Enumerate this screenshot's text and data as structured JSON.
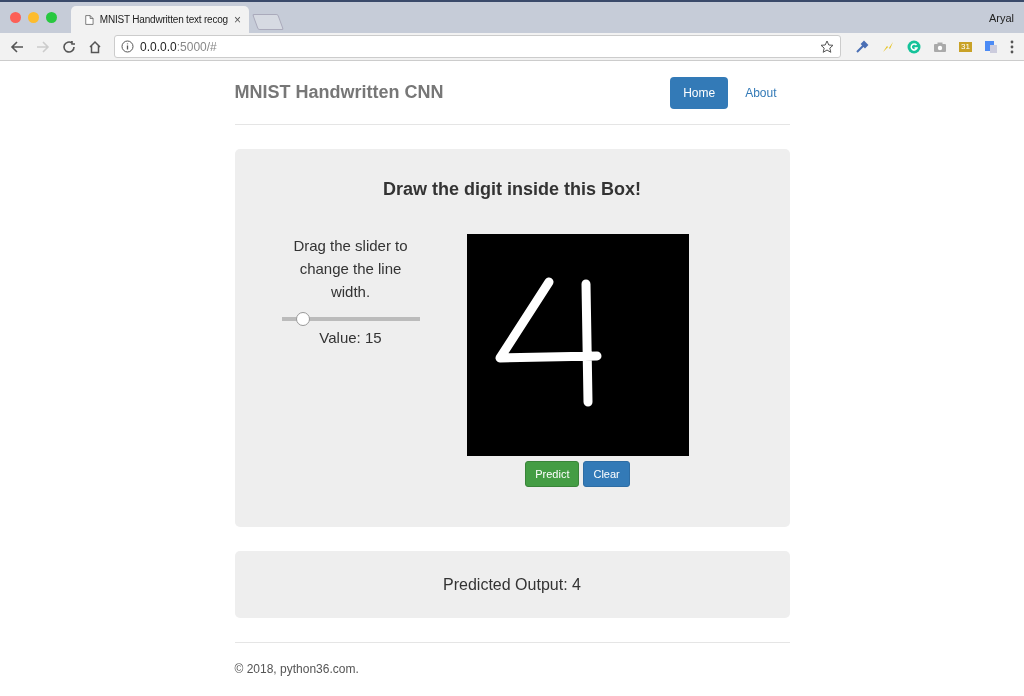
{
  "browser": {
    "tab": {
      "title": "MNIST Handwritten text recog",
      "close": "×"
    },
    "profile": "Aryal",
    "address": {
      "host": "0.0.0.0",
      "path": ":5000/#"
    },
    "calendar_badge": "31"
  },
  "navbar": {
    "brand": "MNIST Handwritten CNN",
    "links": [
      {
        "label": "Home",
        "selected": true
      },
      {
        "label": "About",
        "selected": false
      }
    ]
  },
  "draw_panel": {
    "heading": "Draw the digit inside this Box!",
    "instruction": "Drag the slider to change the line width.",
    "slider": {
      "level": 0.15
    },
    "value_label": "Value: 15",
    "buttons": [
      {
        "label": "Predict",
        "kind": "success"
      },
      {
        "label": "Clear",
        "kind": "primary"
      }
    ]
  },
  "result_panel": {
    "text": "Predicted Output: 4"
  },
  "footer": {
    "text": "© 2018, python36.com."
  }
}
